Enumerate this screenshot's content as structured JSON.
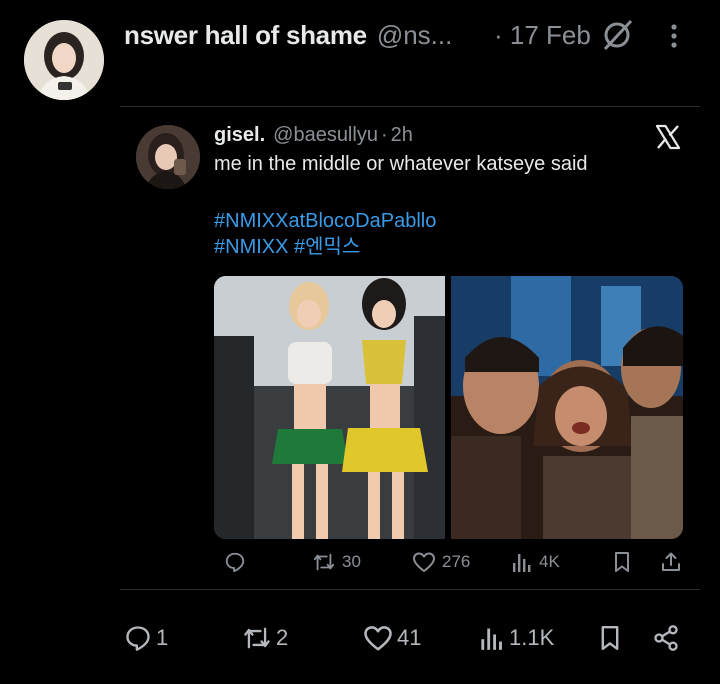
{
  "tweet": {
    "display_name": "nswer hall of shame",
    "handle": "@ns...",
    "date": "· 17 Feb",
    "avatar_icon": "profile-photo",
    "stop_icon": "circle-slash-icon",
    "more_icon": "vertical-dots-icon"
  },
  "quoted": {
    "display_name": "gisel.",
    "handle": "@baesullyu",
    "separator": "·",
    "time": "2h",
    "text": "me in the middle or whatever katseye said",
    "hashtags_line1": "#NMIXXatBlocoDaPabllo",
    "hashtags_line2": "#NMIXX #엔믹스",
    "platform_icon": "x-logo",
    "actions": {
      "retweets": "30",
      "likes": "276",
      "views": "4K"
    }
  },
  "actions": {
    "replies": "1",
    "retweets": "2",
    "likes": "41",
    "views": "1.1K"
  },
  "colors": {
    "background": "#000000",
    "text": "#e7e9ea",
    "muted": "#8b9096",
    "link": "#3a9be8",
    "border": "#2a2d31"
  }
}
